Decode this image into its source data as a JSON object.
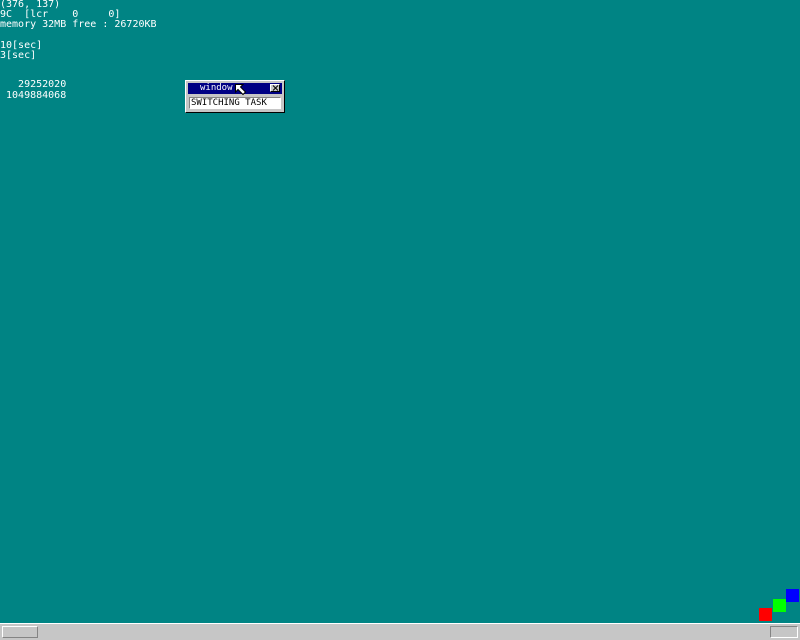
{
  "debug": {
    "mouse_coords": "(376, 137)",
    "keyboard_line": "9C  [lcr    0     0]",
    "memory_line": "memory 32MB free : 26720KB",
    "timer_10": "10[sec]",
    "timer_3": "3[sec]",
    "count_a": "   29252020",
    "count_b": " 1049884068"
  },
  "window": {
    "title": "window",
    "textbox_value": "SWITCHING TASK",
    "close_icon": "close-x-icon"
  },
  "colors": {
    "desktop": "#008484",
    "titlebar": "#000084",
    "square_red": "#ff0000",
    "square_green": "#00ff00",
    "square_blue": "#0000ff"
  }
}
